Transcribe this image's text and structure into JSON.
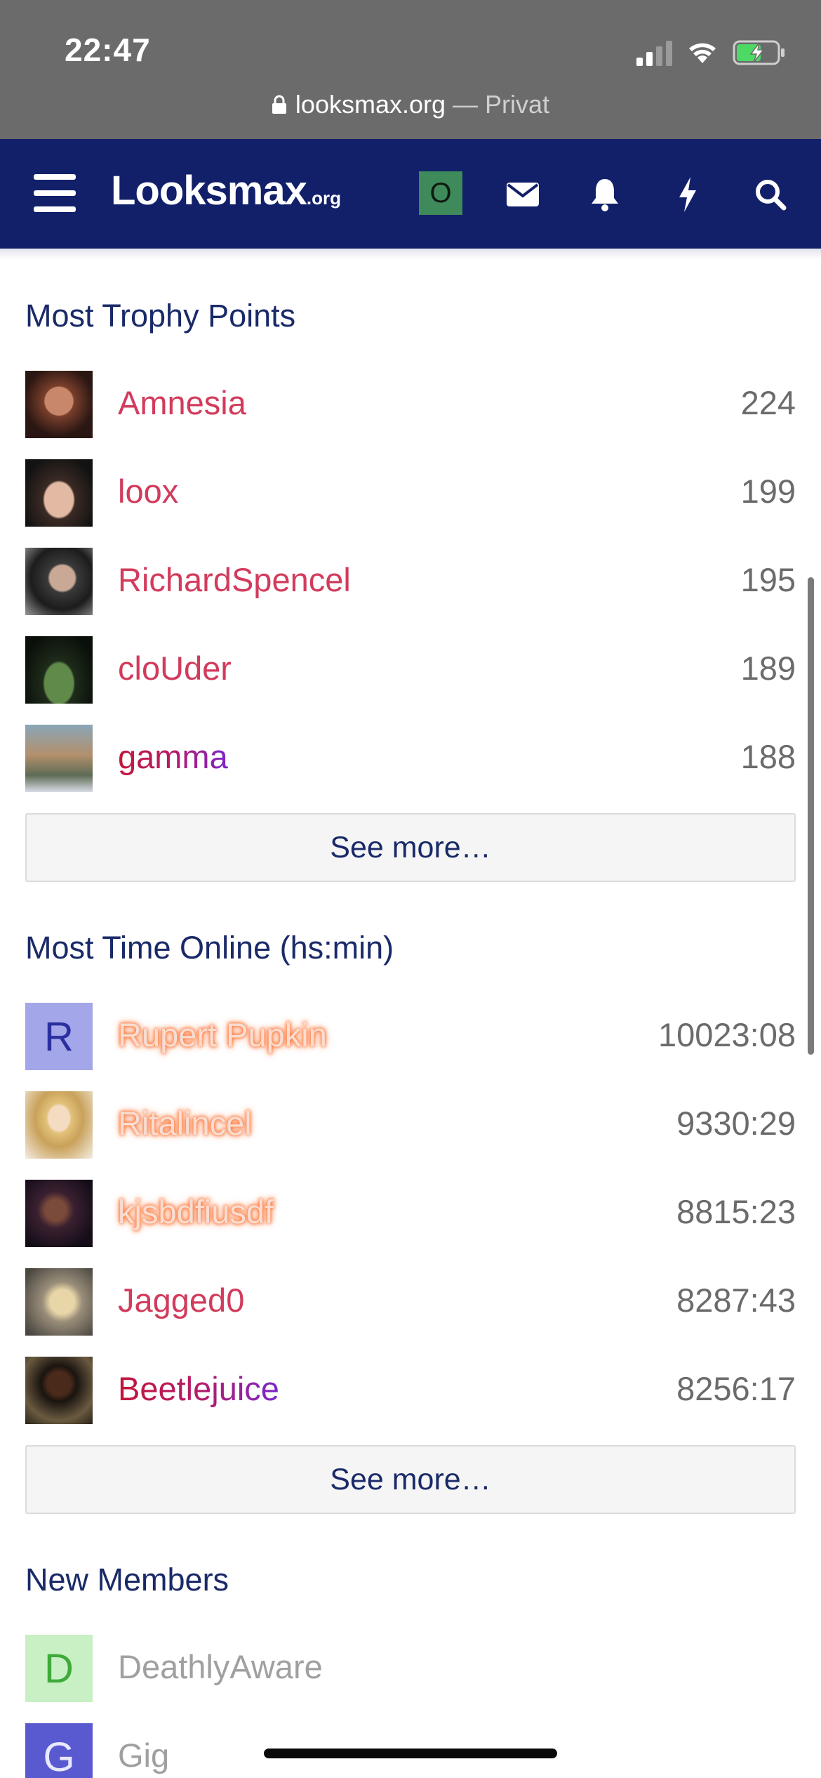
{
  "status_bar": {
    "time": "22:47",
    "url": "looksmax.org",
    "url_suffix": "— Privat",
    "icons": [
      "signal-icon",
      "wifi-icon",
      "battery-charging-icon"
    ]
  },
  "navbar": {
    "logo_main": "Looksmax",
    "logo_suffix": ".org",
    "avatar_letter": "O",
    "avatar_color": "#3e8a5a",
    "icons": [
      "menu-icon",
      "envelope-icon",
      "bell-icon",
      "bolt-icon",
      "search-icon"
    ],
    "background": "#12206a"
  },
  "trophy": {
    "title": "Most Trophy Points",
    "see_more": "See more…",
    "rows": [
      {
        "name": "Amnesia",
        "value": "224"
      },
      {
        "name": "loox",
        "value": "199"
      },
      {
        "name": "RichardSpencel",
        "value": "195"
      },
      {
        "name": "cloUder",
        "value": "189"
      },
      {
        "name": "gamma",
        "value": "188"
      }
    ]
  },
  "online": {
    "title": "Most Time Online (hs:min)",
    "see_more": "See more…",
    "rows": [
      {
        "name": "Rupert Pupkin",
        "value": "10023:08",
        "avatar_letter": "R"
      },
      {
        "name": "Ritalincel",
        "value": "9330:29"
      },
      {
        "name": "kjsbdfiusdf",
        "value": "8815:23"
      },
      {
        "name": "Jagged0",
        "value": "8287:43"
      },
      {
        "name": "Beetlejuice",
        "value": "8256:17"
      }
    ]
  },
  "new_members": {
    "title": "New Members",
    "rows": [
      {
        "name": "DeathlyAware",
        "avatar_letter": "D"
      },
      {
        "name": "Gig",
        "avatar_letter": "G"
      }
    ]
  },
  "colors": {
    "username": "#d23b5c",
    "section_title": "#1a2a68",
    "glow": "#ff7a3a"
  }
}
